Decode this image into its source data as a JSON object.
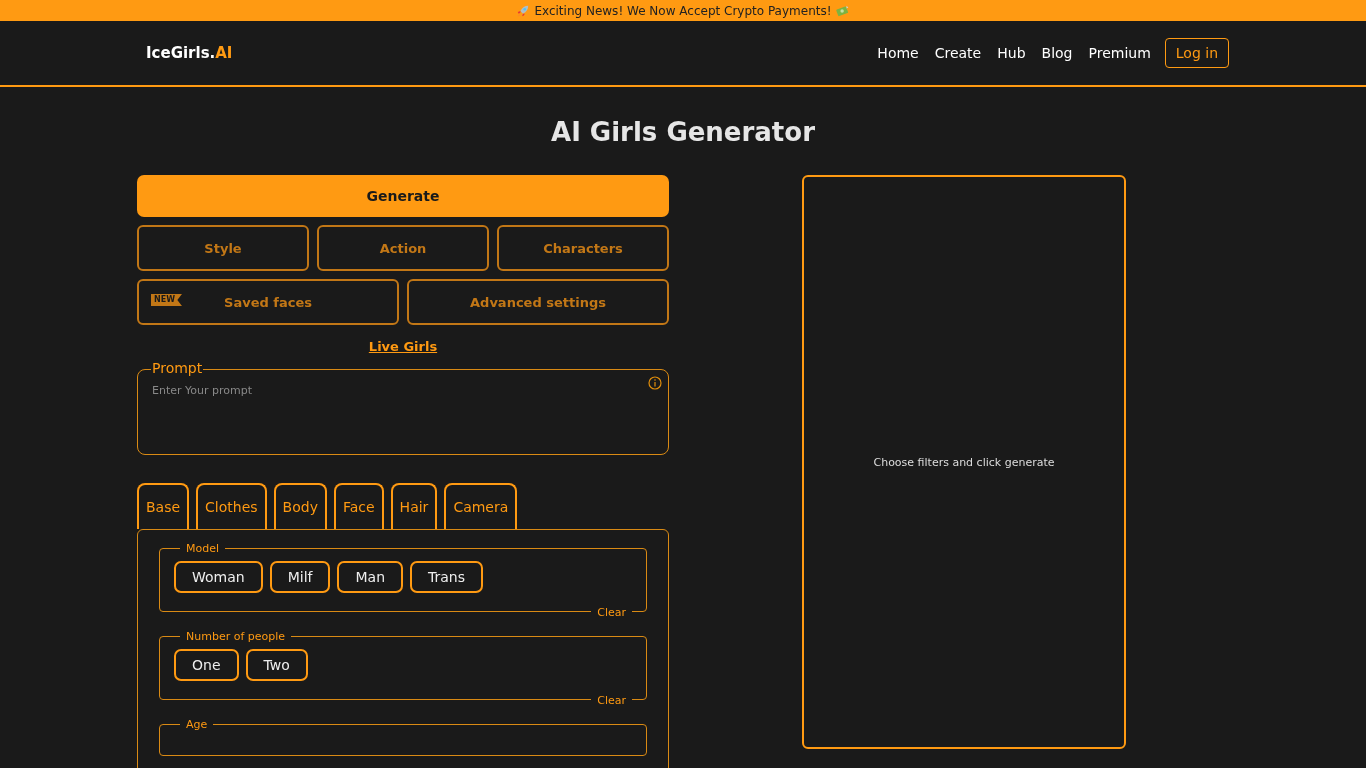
{
  "banner": {
    "text": "Exciting News! We Now Accept Crypto Payments!"
  },
  "logo": {
    "text": "IceGirls.",
    "accent": "AI"
  },
  "nav": {
    "links": [
      "Home",
      "Create",
      "Hub",
      "Blog",
      "Premium"
    ],
    "login": "Log in"
  },
  "page_title": "AI Girls Generator",
  "generate_button": "Generate",
  "option_buttons": [
    {
      "label": "Style"
    },
    {
      "label": "Action"
    },
    {
      "label": "Characters"
    }
  ],
  "option_buttons_2": [
    {
      "label": "Saved faces",
      "badge": "NEW"
    },
    {
      "label": "Advanced settings"
    }
  ],
  "live_link": "Live Girls",
  "prompt": {
    "label": "Prompt",
    "placeholder": "Enter Your prompt"
  },
  "tabs": [
    {
      "label": "Base",
      "selected": false
    },
    {
      "label": "Clothes",
      "selected": false
    },
    {
      "label": "Body",
      "selected": false
    },
    {
      "label": "Face",
      "selected": false
    },
    {
      "label": "Hair",
      "selected": false
    },
    {
      "label": "Camera",
      "selected": false
    }
  ],
  "sections": [
    {
      "title": "Model",
      "clear": "Clear",
      "options": [
        {
          "label": "Woman",
          "selected": false
        },
        {
          "label": "Milf",
          "selected": false
        },
        {
          "label": "Man",
          "selected": false
        },
        {
          "label": "Trans",
          "selected": false
        }
      ]
    },
    {
      "title": "Number of people",
      "clear": "Clear",
      "options": [
        {
          "label": "One",
          "selected": false
        },
        {
          "label": "Two",
          "selected": false
        }
      ]
    },
    {
      "title": "Age"
    }
  ],
  "preview": {
    "message": "Choose filters and click generate"
  }
}
